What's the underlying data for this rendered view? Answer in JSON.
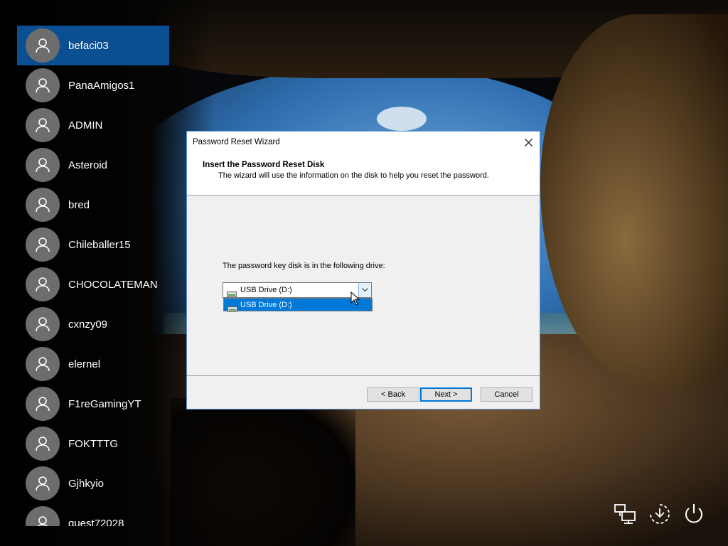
{
  "users": [
    {
      "name": "befaci03",
      "selected": true
    },
    {
      "name": "PanaAmigos1"
    },
    {
      "name": "ADMIN"
    },
    {
      "name": "Asteroid"
    },
    {
      "name": "bred"
    },
    {
      "name": "Chileballer15"
    },
    {
      "name": "CHOCOLATEMAN"
    },
    {
      "name": "cxnzy09"
    },
    {
      "name": "elernel"
    },
    {
      "name": "F1reGamingYT"
    },
    {
      "name": "FOKTTTG"
    },
    {
      "name": "Gjhkyio"
    },
    {
      "name": "guest72028"
    }
  ],
  "dialog": {
    "title": "Password Reset Wizard",
    "close_icon": "close-icon",
    "header_title": "Insert the Password Reset Disk",
    "header_desc": "The wizard will use the information on the disk to help you reset the password.",
    "prompt": "The password key disk is in the following drive:",
    "drive_select": {
      "value": "USB Drive (D:)",
      "options": [
        "USB Drive (D:)"
      ],
      "highlighted_option": "USB Drive (D:)",
      "icon": "usb-drive-icon"
    },
    "buttons": {
      "back": "< Back",
      "next": "Next >",
      "cancel": "Cancel"
    }
  },
  "system_icons": [
    "network-icon",
    "ease-of-access-icon",
    "power-icon"
  ],
  "colors": {
    "selected_user_bg": "#0b4f93",
    "accent": "#0078d7",
    "avatar_bg": "#6d6d6d"
  }
}
